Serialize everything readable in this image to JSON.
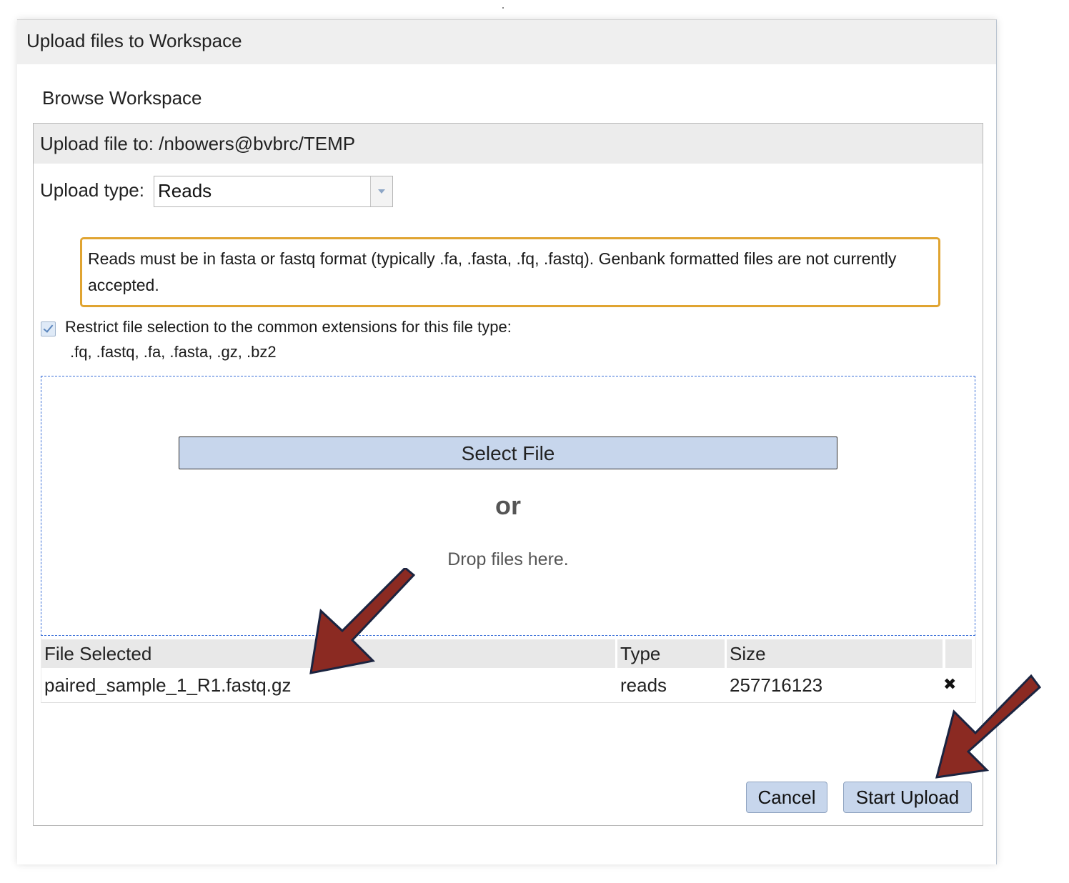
{
  "dialog": {
    "title": "Upload files to Workspace",
    "subtitle": "Browse Workspace"
  },
  "panel": {
    "upload_path": "Upload file to: /nbowers@bvbrc/TEMP",
    "type_label": "Upload type:",
    "type_value": "Reads",
    "notice": "Reads must be in fasta or fastq format (typically .fa, .fasta, .fq, .fastq). Genbank formatted files are not currently accepted.",
    "restrict_label": "Restrict file selection to the common extensions for this file type:",
    "restrict_checked": true,
    "extensions": ".fq, .fastq, .fa, .fasta, .gz, .bz2"
  },
  "dropzone": {
    "select_file_label": "Select File",
    "or_text": "or",
    "drop_text": "Drop files here."
  },
  "file_table": {
    "headers": [
      "File Selected",
      "Type",
      "Size"
    ],
    "rows": [
      {
        "file": "paired_sample_1_R1.fastq.gz",
        "type": "reads",
        "size": "257716123",
        "remove_icon": "close-icon"
      }
    ]
  },
  "buttons": {
    "cancel_label": "Cancel",
    "start_upload_label": "Start Upload"
  },
  "colors": {
    "notice_border": "#e0a431",
    "button_bg": "#c7d6ec",
    "dropzone_border": "#3a6fd8",
    "annotation_arrow": "#8b2a22"
  }
}
